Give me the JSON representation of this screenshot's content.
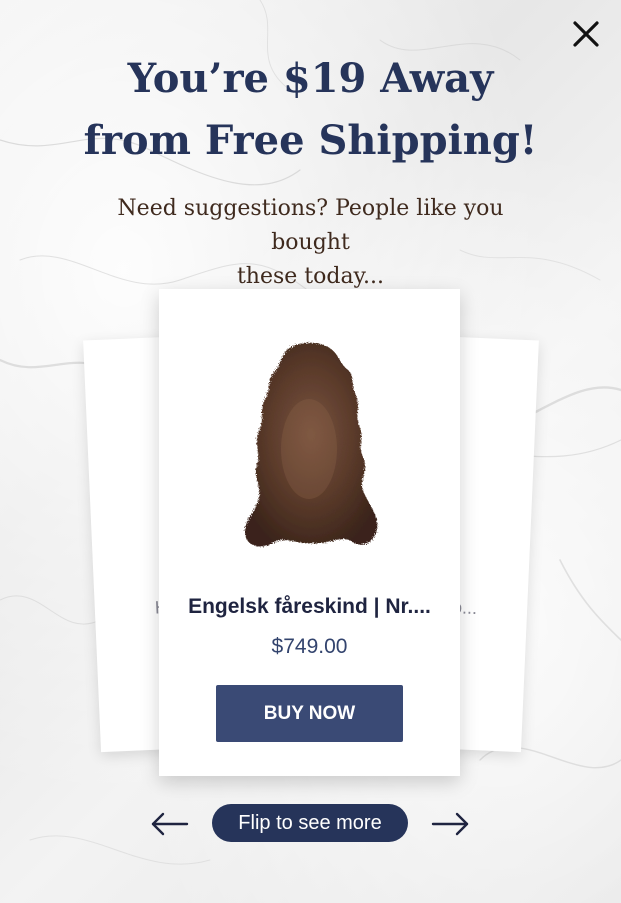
{
  "popup": {
    "headline_line1": "You’re $19 Away",
    "headline_line2": "from Free Shipping!",
    "subhead_line1": "Need suggestions? People like you bought",
    "subhead_line2": "these today...",
    "close_icon": "close-icon"
  },
  "carousel": {
    "prev_card": {
      "title_fragment": "H"
    },
    "next_card": {
      "title_fragment": "o..."
    },
    "current_card": {
      "title": "Engelsk fåreskind | Nr....",
      "price": "$749.00",
      "button_label": "BUY NOW",
      "image_icon": "sheepskin-rug-image"
    },
    "flip_label": "Flip to see more",
    "prev_icon": "arrow-left-icon",
    "next_icon": "arrow-right-icon"
  },
  "colors": {
    "navy": "#26345a",
    "button": "#3a4a75",
    "price": "#33446e",
    "subhead": "#3f2a1e"
  }
}
